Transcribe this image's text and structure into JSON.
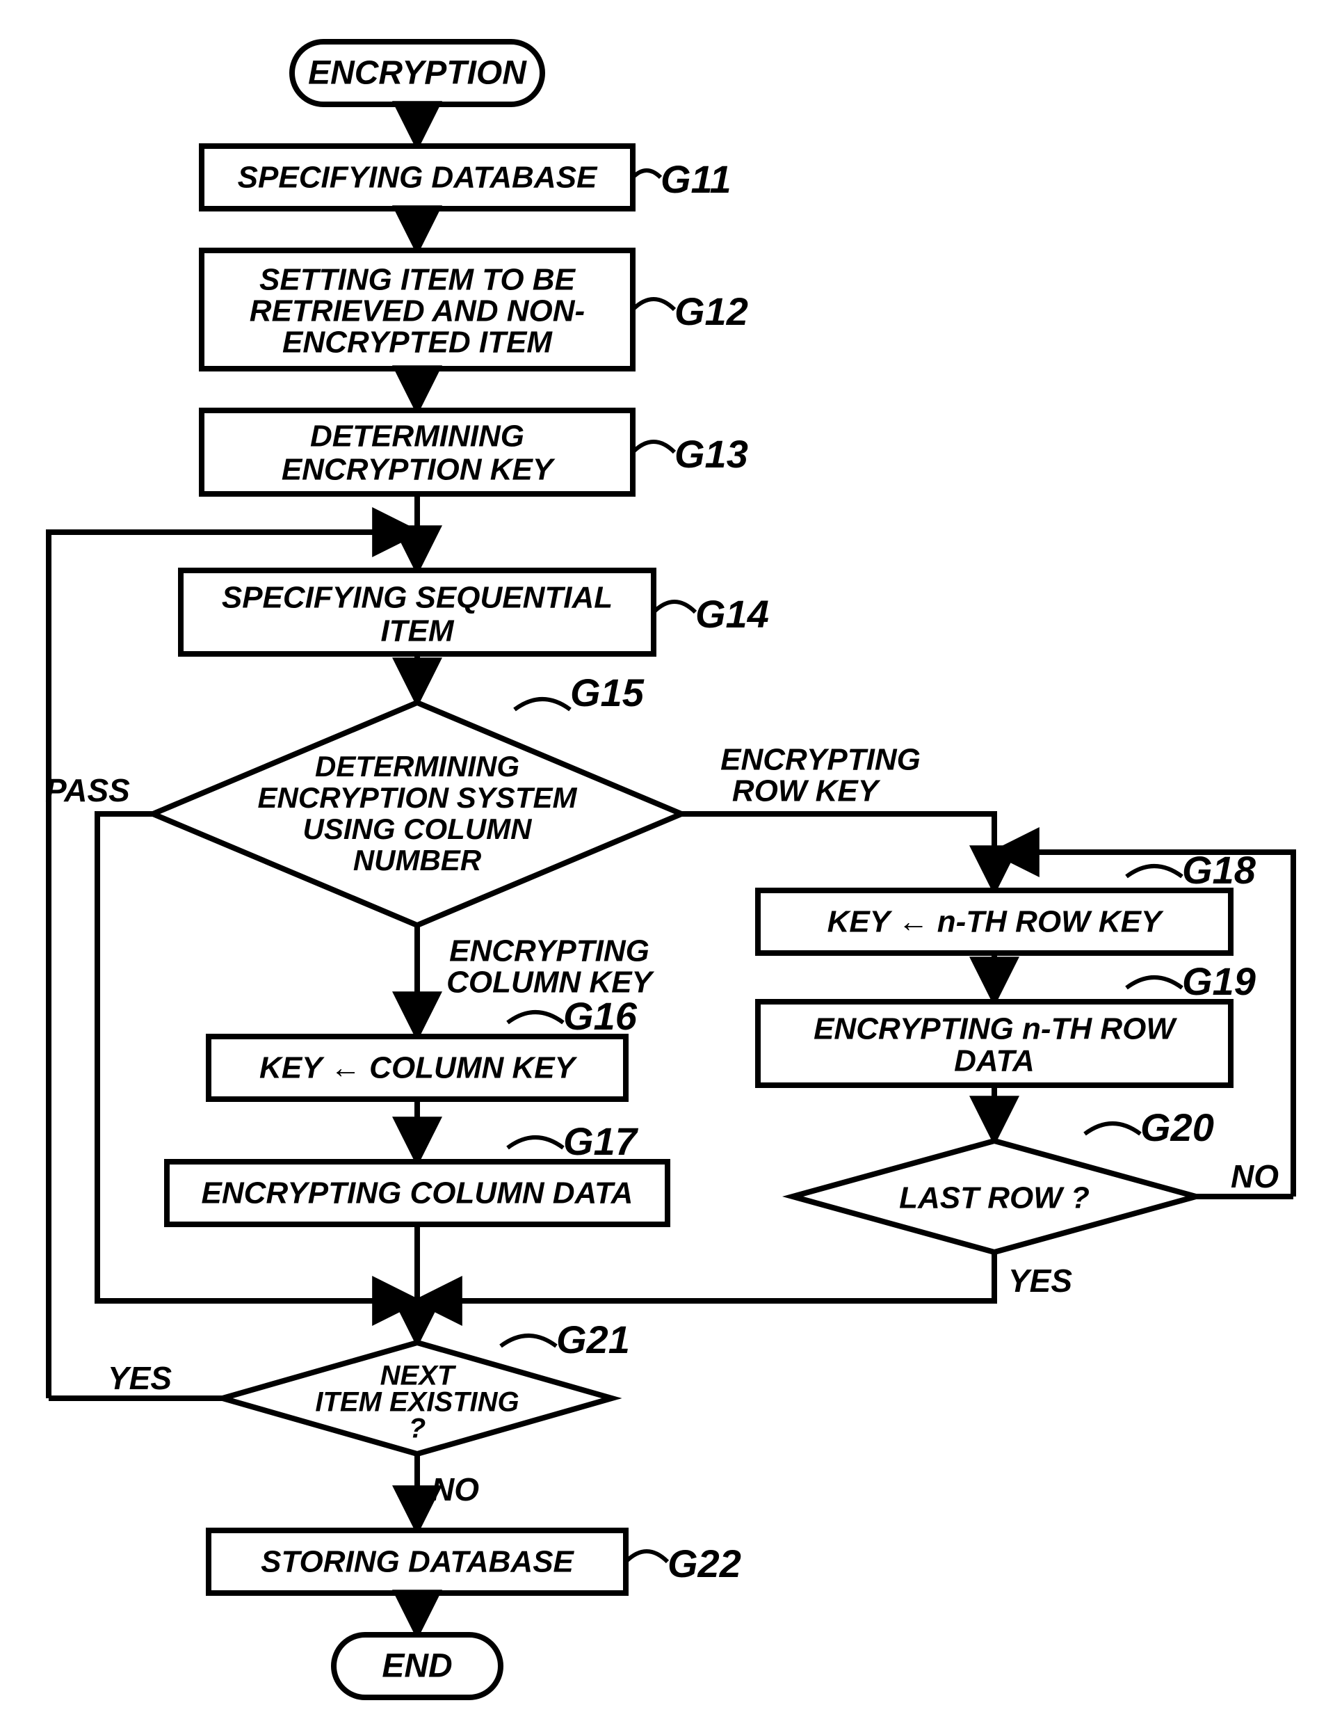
{
  "flowchart": {
    "start": "ENCRYPTION",
    "end": "END",
    "steps": {
      "g11": {
        "label": "G11",
        "text": "SPECIFYING DATABASE"
      },
      "g12": {
        "label": "G12",
        "text1": "SETTING ITEM TO BE",
        "text2": "RETRIEVED AND NON-",
        "text3": "ENCRYPTED ITEM"
      },
      "g13": {
        "label": "G13",
        "text1": "DETERMINING",
        "text2": "ENCRYPTION KEY"
      },
      "g14": {
        "label": "G14",
        "text1": "SPECIFYING SEQUENTIAL",
        "text2": "ITEM"
      },
      "g15": {
        "label": "G15",
        "text1": "DETERMINING",
        "text2": "ENCRYPTION SYSTEM",
        "text3": "USING COLUMN",
        "text4": "NUMBER"
      },
      "g16": {
        "label": "G16",
        "text": "KEY ← COLUMN KEY"
      },
      "g17": {
        "label": "G17",
        "text": "ENCRYPTING COLUMN DATA"
      },
      "g18": {
        "label": "G18",
        "text": "KEY ← n-TH ROW KEY"
      },
      "g19": {
        "label": "G19",
        "text1": "ENCRYPTING n-TH ROW",
        "text2": "DATA"
      },
      "g20": {
        "label": "G20",
        "text": "LAST ROW ?"
      },
      "g21": {
        "label": "G21",
        "text1": "NEXT",
        "text2": "ITEM EXISTING",
        "text3": "?"
      },
      "g22": {
        "label": "G22",
        "text": "STORING DATABASE"
      }
    },
    "edges": {
      "pass": "PASS",
      "enc_col_key1": "ENCRYPTING",
      "enc_col_key2": "COLUMN KEY",
      "enc_row_key1": "ENCRYPTING",
      "enc_row_key2": "ROW KEY",
      "yes": "YES",
      "no": "NO"
    }
  }
}
